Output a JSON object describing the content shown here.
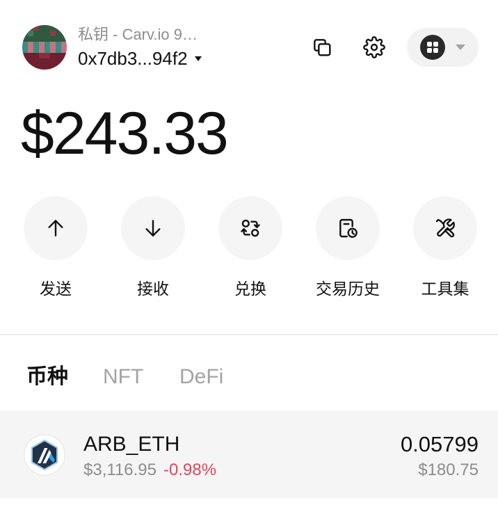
{
  "account": {
    "name": "私钥 - Carv.io 9…",
    "address": "0x7db3...94f2"
  },
  "header": {
    "copy_icon": "copy-icon",
    "settings_icon": "gear-icon",
    "apps_icon": "grid-icon",
    "apps_caret_icon": "chevron-down-icon"
  },
  "balance": "$243.33",
  "actions": [
    {
      "label": "发送",
      "icon": "arrow-up-icon"
    },
    {
      "label": "接收",
      "icon": "arrow-down-icon"
    },
    {
      "label": "兑换",
      "icon": "swap-icon"
    },
    {
      "label": "交易历史",
      "icon": "history-icon"
    },
    {
      "label": "工具集",
      "icon": "tools-icon"
    }
  ],
  "tabs": [
    {
      "label": "币种",
      "active": true
    },
    {
      "label": "NFT",
      "active": false
    },
    {
      "label": "DeFi",
      "active": false
    }
  ],
  "tokens": [
    {
      "icon": "arbitrum-logo-icon",
      "symbol": "ARB_ETH",
      "price": "$3,116.95",
      "change": "-0.98%",
      "amount": "0.05799",
      "value": "$180.75"
    }
  ],
  "colors": {
    "text": "#111111",
    "muted": "#8c8c8c",
    "negative": "#e0465c",
    "surface": "#f5f5f5"
  }
}
